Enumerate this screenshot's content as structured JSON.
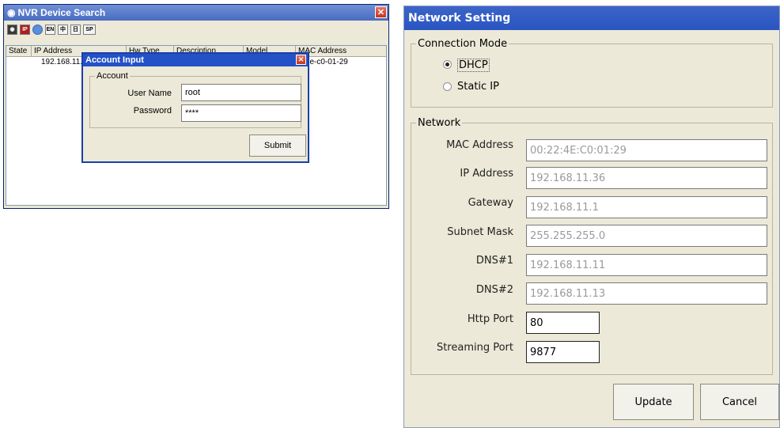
{
  "nvr_window": {
    "title": "NVR Device Search",
    "toolbar": {
      "en_label": "EN",
      "zh_label": "中",
      "jp_label": "日",
      "sp_label": "SP"
    },
    "columns": [
      "State",
      "IP Address",
      "Hw Type",
      "Description",
      "Model",
      "MAC Address"
    ],
    "row": {
      "ip": "192.168.11.3",
      "mac": "2-4e-c0-01-29"
    }
  },
  "account_dialog": {
    "title": "Account Input",
    "group_label": "Account",
    "user_name_label": "User Name",
    "user_name_value": "root",
    "password_label": "Password",
    "password_value": "****",
    "submit_label": "Submit"
  },
  "network_window": {
    "title": "Network Setting",
    "connection_mode": {
      "legend": "Connection Mode",
      "dhcp_label": "DHCP",
      "static_label": "Static IP",
      "selected": "DHCP"
    },
    "network": {
      "legend": "Network",
      "mac_label": "MAC Address",
      "mac_value": "00:22:4E:C0:01:29",
      "ip_label": "IP Address",
      "ip_value": "192.168.11.36",
      "gateway_label": "Gateway",
      "gateway_value": "192.168.11.1",
      "subnet_label": "Subnet Mask",
      "subnet_value": "255.255.255.0",
      "dns1_label": "DNS#1",
      "dns1_value": "192.168.11.11",
      "dns2_label": "DNS#2",
      "dns2_value": "192.168.11.13",
      "http_port_label": "Http Port",
      "http_port_value": "80",
      "streaming_port_label": "Streaming Port",
      "streaming_port_value": "9877"
    },
    "update_label": "Update",
    "cancel_label": "Cancel"
  }
}
